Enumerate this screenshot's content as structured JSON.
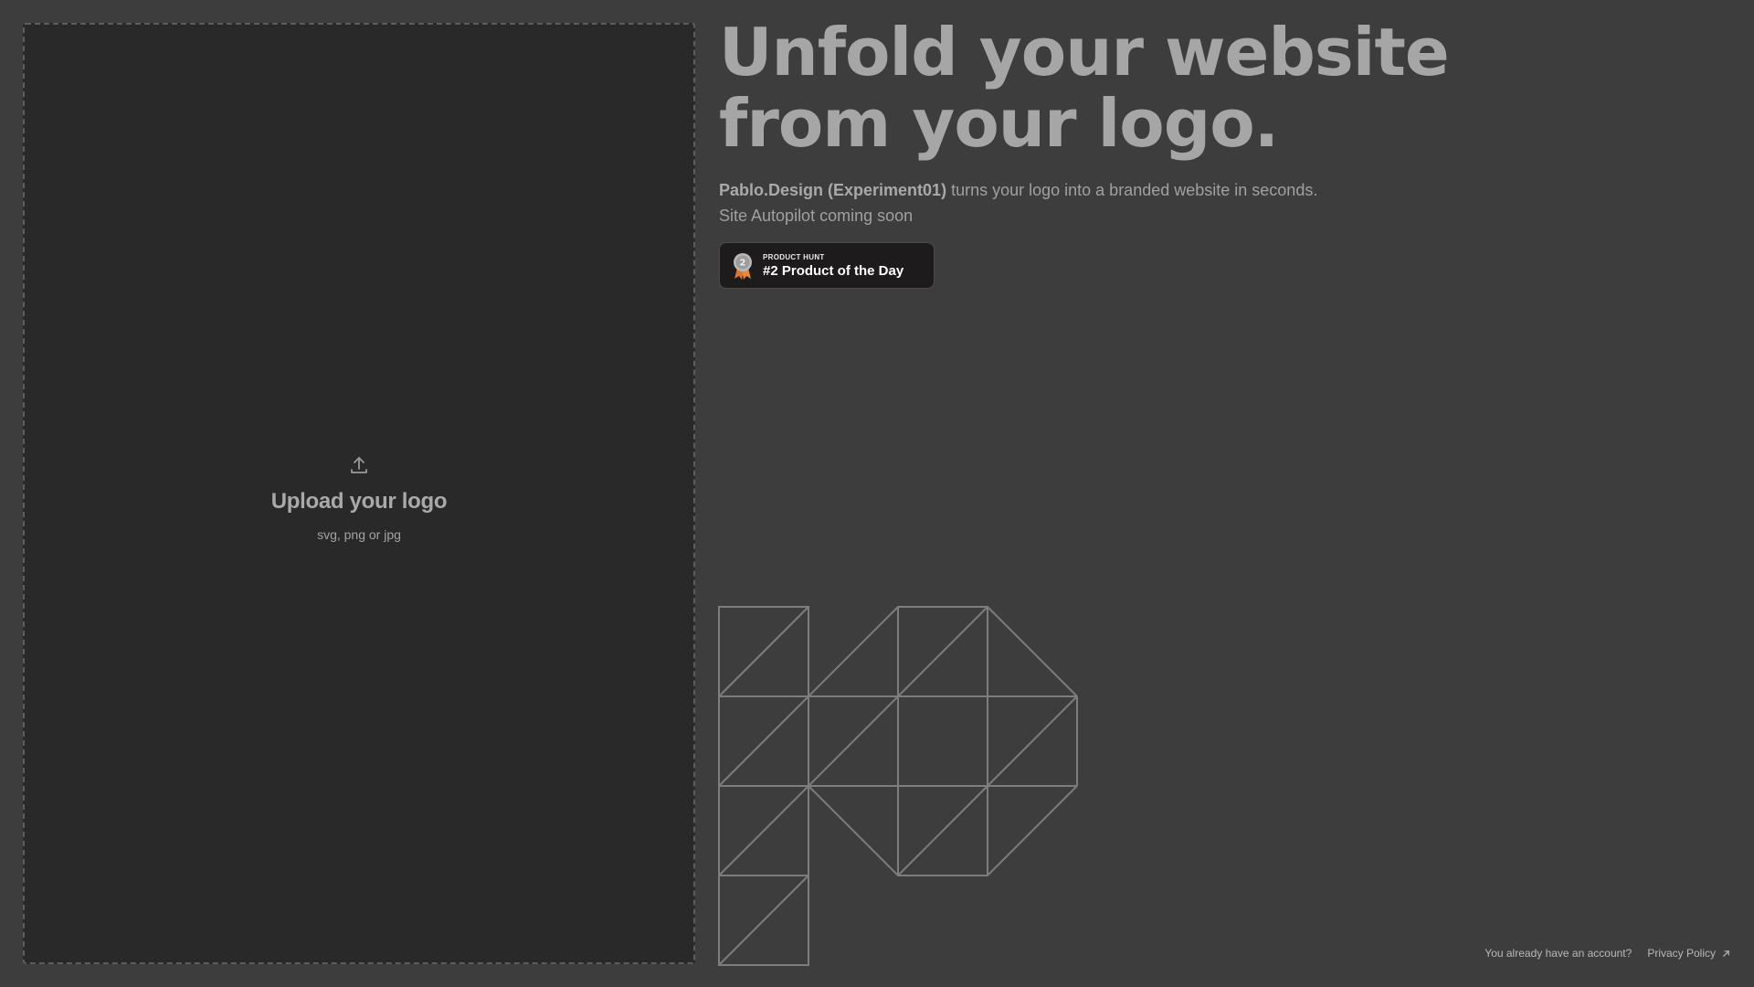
{
  "upload": {
    "title": "Upload your logo",
    "formats": "svg, png or jpg",
    "icon": "upload-icon"
  },
  "hero": {
    "headline_line1": "Unfold your website",
    "headline_line2": "from your logo.",
    "brand": "Pablo.Design (Experiment01)",
    "description": " turns your logo into a branded website in seconds.",
    "subline": "Site Autopilot coming soon"
  },
  "badge": {
    "kicker": "PRODUCT HUNT",
    "title": "#2 Product of the Day",
    "rank": "2",
    "icon": "medal-icon"
  },
  "footer": {
    "account_link": "You already have an account?",
    "privacy_link": "Privacy Policy",
    "external_icon": "external-link-icon"
  },
  "colors": {
    "background": "#3d3d3d",
    "upload_panel": "#292929",
    "headline": "#a6a6a6",
    "logo_stroke": "#7d7d7d",
    "badge_bg": "#1d1b1c"
  }
}
